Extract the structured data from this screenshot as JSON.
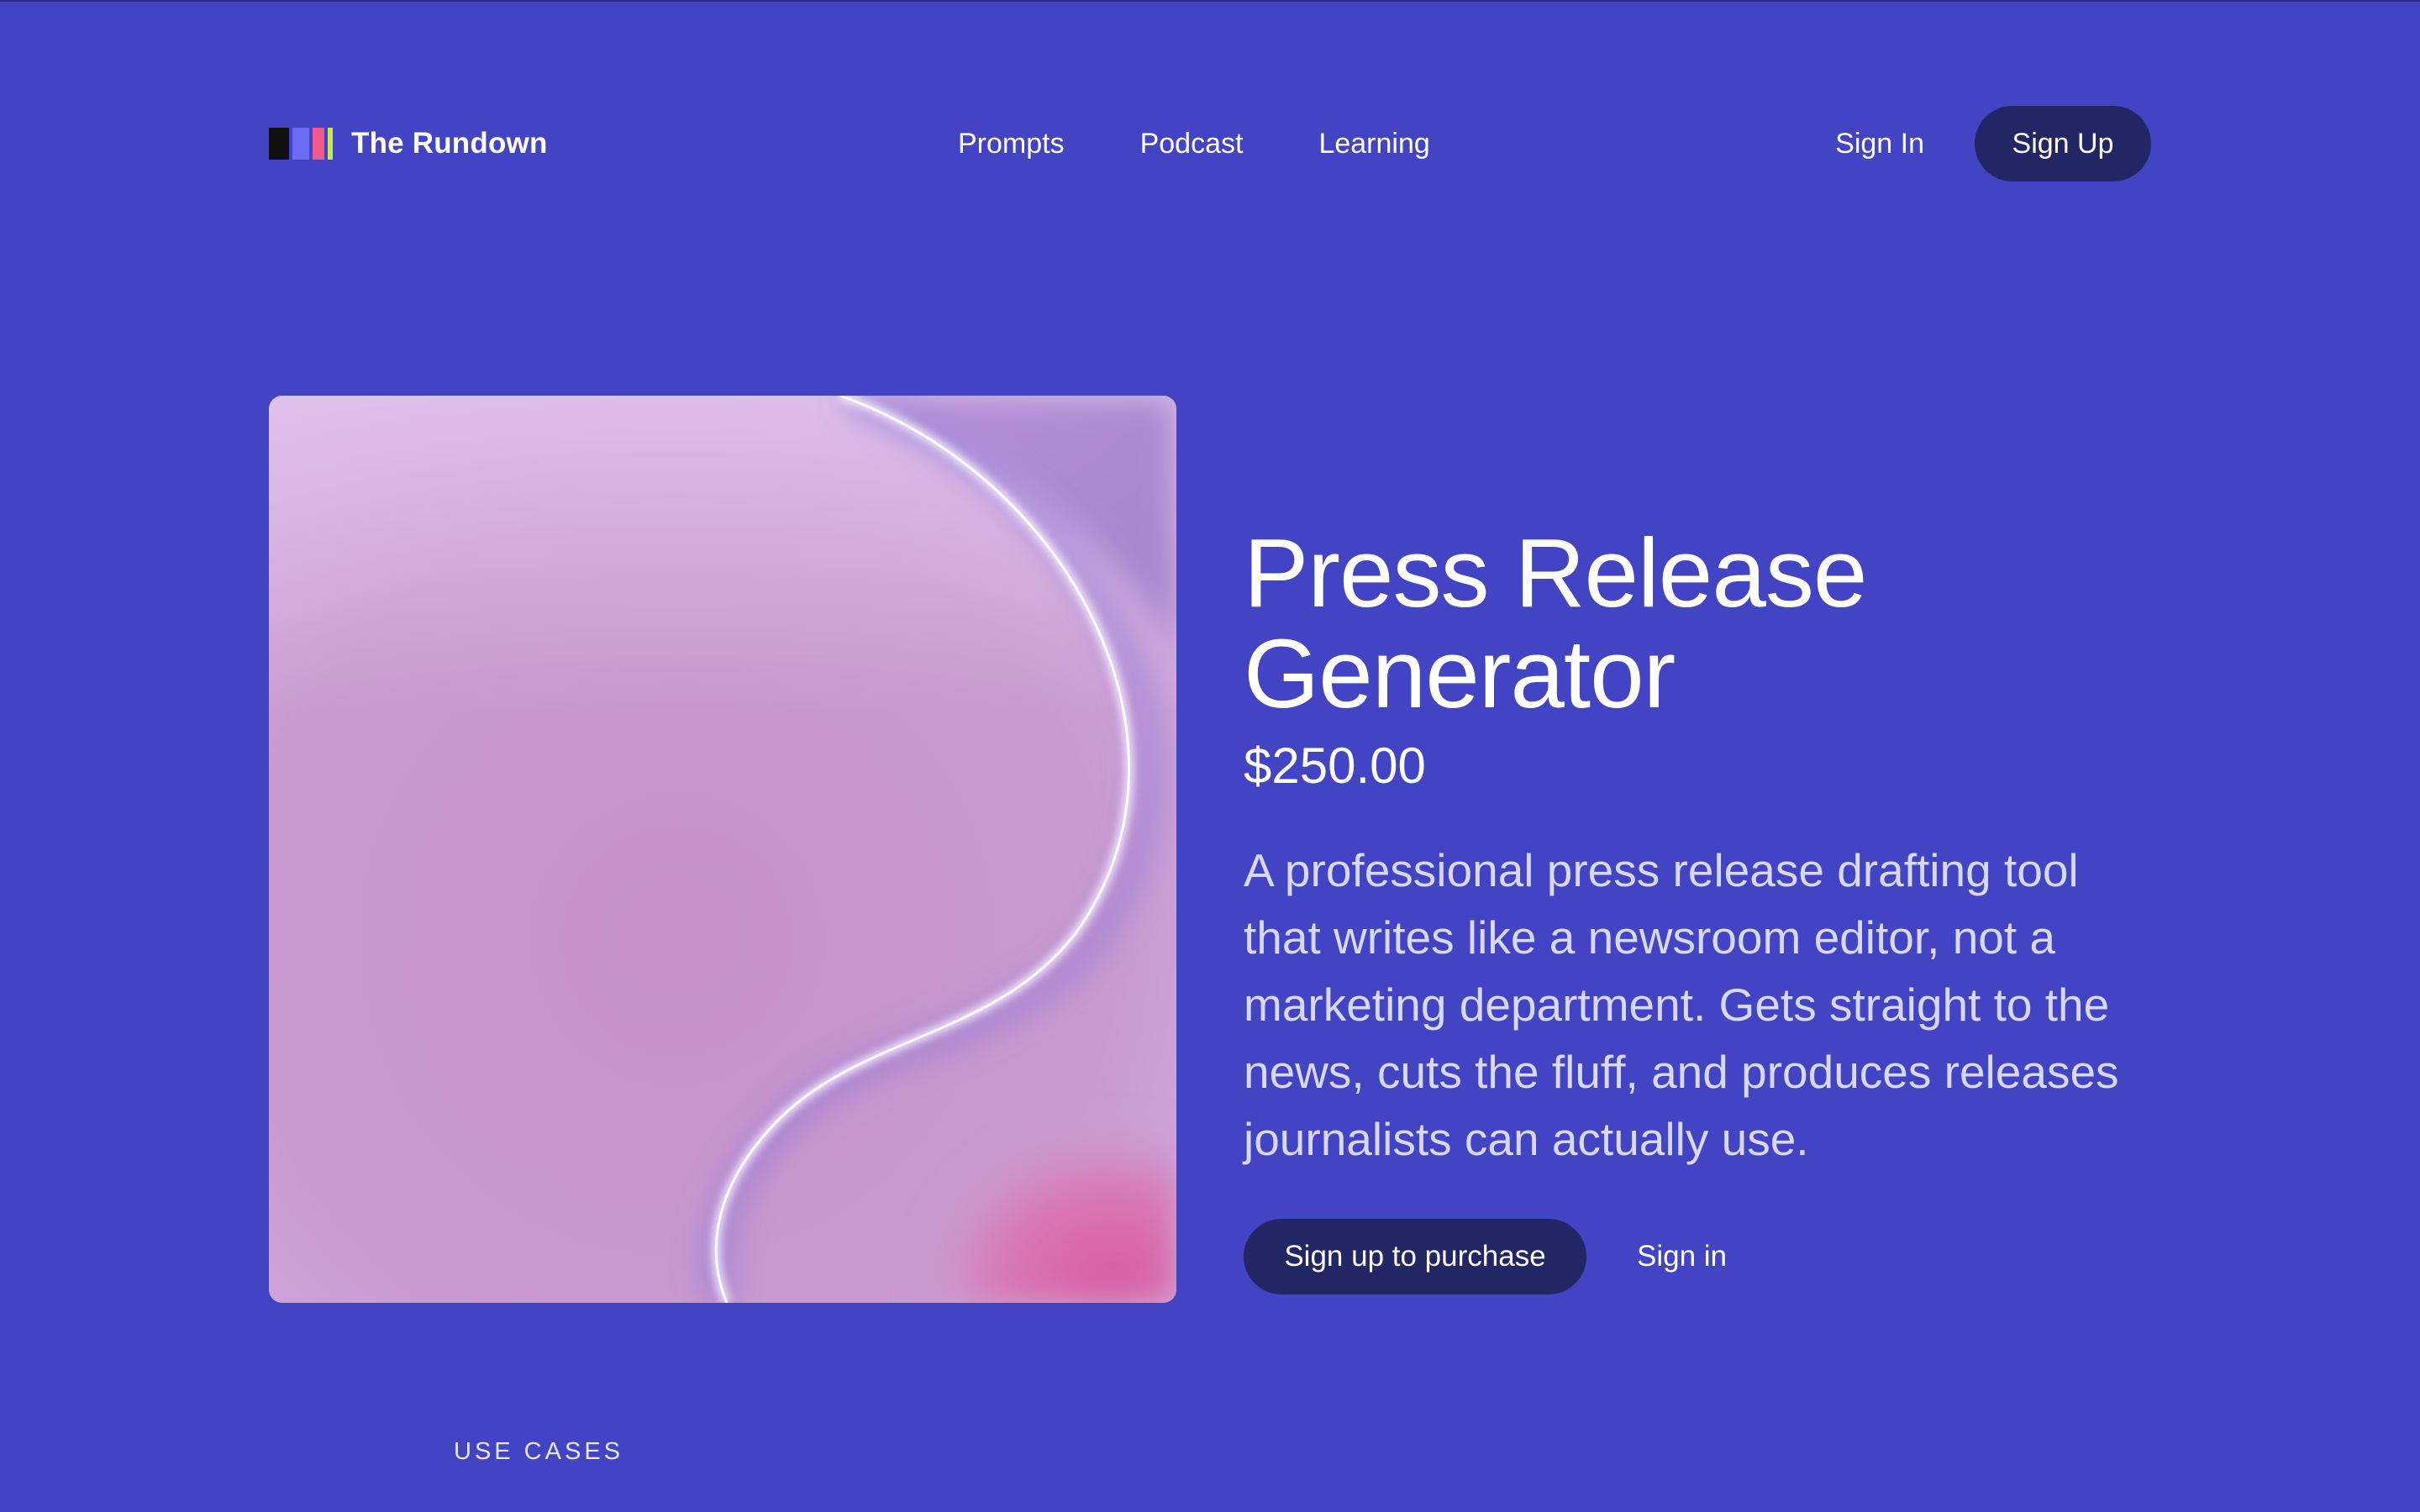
{
  "header": {
    "brand_name": "The Rundown",
    "nav": [
      {
        "label": "Prompts"
      },
      {
        "label": "Podcast"
      },
      {
        "label": "Learning"
      }
    ],
    "sign_in_label": "Sign In",
    "sign_up_label": "Sign Up"
  },
  "product": {
    "title": "Press Release Generator",
    "price": "$250.00",
    "description": "A professional press release drafting tool that writes like a newsroom editor, not a marketing department. Gets straight to the news, cuts the fluff, and produces releases journalists can actually use.",
    "purchase_label": "Sign up to purchase",
    "sign_in_label": "Sign in",
    "image_icon": "abstract-gradient-artwork"
  },
  "sections": {
    "use_cases_label": "USE CASES"
  },
  "colors": {
    "background": "#4244c4",
    "button_dark": "#232665",
    "description_text": "#d7d8ff",
    "brand_black": "#111111",
    "brand_violet": "#6d6cf5",
    "brand_pink": "#ef5a8a",
    "brand_lime": "#c8e84a"
  }
}
